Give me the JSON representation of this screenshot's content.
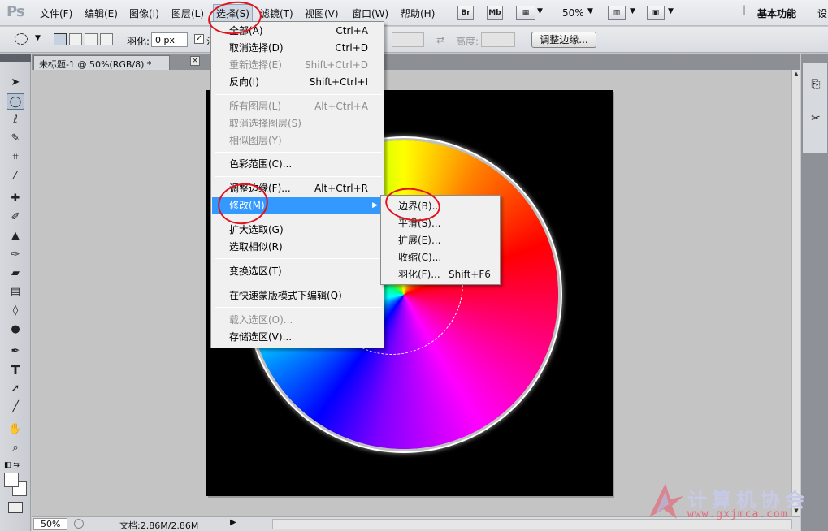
{
  "menubar": {
    "logo": "Ps",
    "items": [
      "文件(F)",
      "编辑(E)",
      "图像(I)",
      "图层(L)",
      "选择(S)",
      "滤镜(T)",
      "视图(V)",
      "窗口(W)",
      "帮助(H)"
    ],
    "bridge": "Br",
    "minibridge": "Mb",
    "zoom": "50%",
    "workspace": "基本功能",
    "workspace_more": "设"
  },
  "options": {
    "feather_label": "羽化:",
    "feather_value": "0 px",
    "antialias_partial": "消",
    "height_label": "高度:",
    "refine_button": "调整边缘..."
  },
  "document": {
    "tab_title": "未标题-1 @ 50%(RGB/8) *",
    "close_glyph": "×"
  },
  "status": {
    "zoom": "50%",
    "doc_info": "文档:2.86M/2.86M"
  },
  "select_menu": {
    "items": [
      {
        "label": "全部(A)",
        "shortcut": "Ctrl+A"
      },
      {
        "label": "取消选择(D)",
        "shortcut": "Ctrl+D"
      },
      {
        "label": "重新选择(E)",
        "shortcut": "Shift+Ctrl+D",
        "disabled": true
      },
      {
        "label": "反向(I)",
        "shortcut": "Shift+Ctrl+I"
      },
      {
        "label": "所有图层(L)",
        "shortcut": "Alt+Ctrl+A",
        "disabled": true
      },
      {
        "label": "取消选择图层(S)",
        "shortcut": "",
        "disabled": true
      },
      {
        "label": "相似图层(Y)",
        "shortcut": "",
        "disabled": true
      },
      {
        "label": "色彩范围(C)...",
        "shortcut": ""
      },
      {
        "label": "调整边缘(F)...",
        "shortcut": "Alt+Ctrl+R"
      },
      {
        "label": "修改(M)",
        "shortcut": "",
        "highlighted": true
      },
      {
        "label": "扩大选取(G)",
        "shortcut": ""
      },
      {
        "label": "选取相似(R)",
        "shortcut": ""
      },
      {
        "label": "变换选区(T)",
        "shortcut": ""
      },
      {
        "label": "在快速蒙版模式下编辑(Q)",
        "shortcut": ""
      },
      {
        "label": "载入选区(O)...",
        "shortcut": "",
        "disabled": true
      },
      {
        "label": "存储选区(V)...",
        "shortcut": ""
      }
    ]
  },
  "modify_submenu": {
    "items": [
      {
        "label": "边界(B)...",
        "shortcut": ""
      },
      {
        "label": "平滑(S)...",
        "shortcut": ""
      },
      {
        "label": "扩展(E)...",
        "shortcut": ""
      },
      {
        "label": "收缩(C)...",
        "shortcut": ""
      },
      {
        "label": "羽化(F)...",
        "shortcut": "Shift+F6"
      }
    ]
  },
  "watermark": {
    "text": "计算机协会",
    "url": "www.gxjmca.com"
  },
  "colors": {
    "menu_highlight": "#3399ff",
    "annotation_red": "#e0141f",
    "canvas_bg": "#000000",
    "foreground": "#ffffff",
    "background": "#ffffff"
  }
}
